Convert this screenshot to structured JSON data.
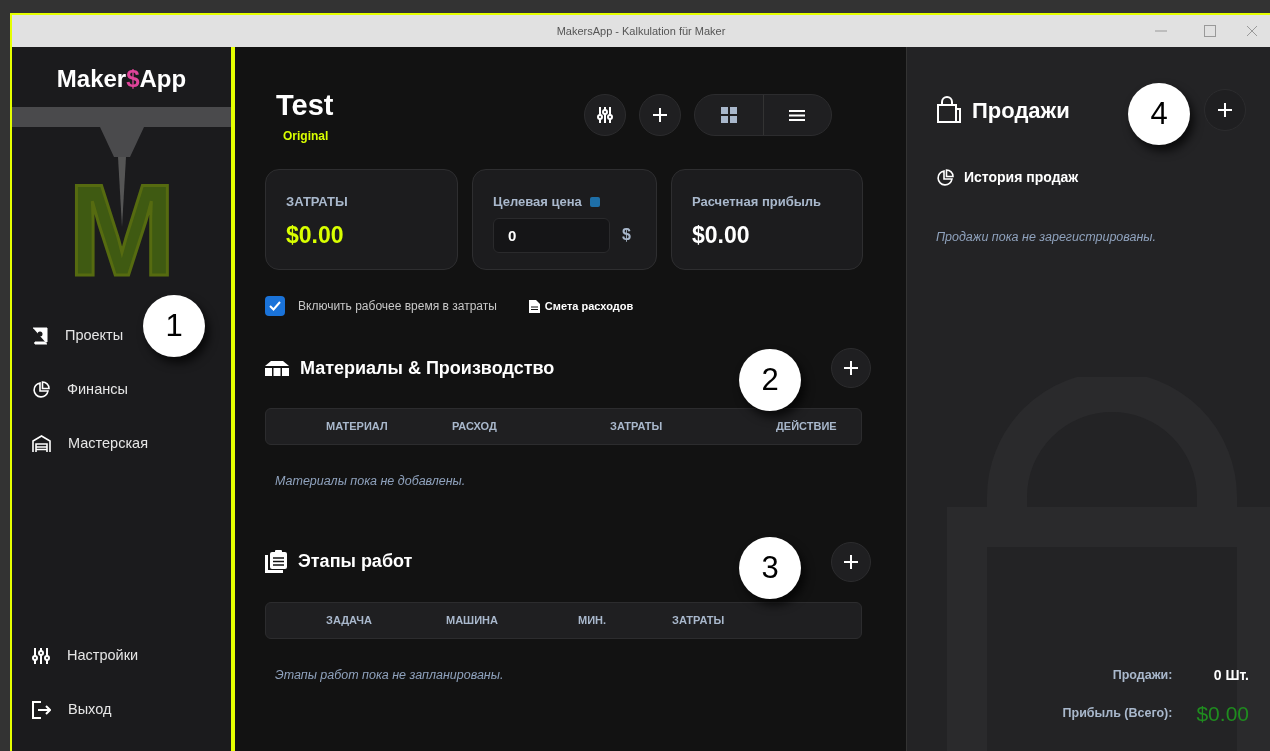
{
  "window": {
    "title": "MakersApp - Kalkulation für Maker"
  },
  "sidebar": {
    "logo": {
      "before": "Maker",
      "symbol": "$",
      "after": "App",
      "art_letter": "M"
    },
    "nav": [
      {
        "kind": "projects",
        "label": "Проекты"
      },
      {
        "kind": "finance",
        "label": "Финансы"
      },
      {
        "kind": "workshop",
        "label": "Мастерская"
      }
    ],
    "bottom_nav": [
      {
        "kind": "settings",
        "label": "Настройки"
      },
      {
        "kind": "logout",
        "label": "Выход"
      }
    ]
  },
  "project": {
    "title": "Test",
    "variant": "Original"
  },
  "cards": [
    {
      "kind": "value",
      "label": "ЗАТРАТЫ",
      "value": "$0.00",
      "highlight": true
    },
    {
      "kind": "input",
      "label": "Целевая цена",
      "value": "0",
      "unit": "$",
      "info": true
    },
    {
      "kind": "value",
      "label": "Расчетная прибыль",
      "value": "$0.00",
      "highlight": false
    }
  ],
  "include_work_time": {
    "label": "Включить рабочее время в затраты",
    "checked": true
  },
  "cost_estimate_link": "Смета расходов",
  "sections": [
    {
      "kind": "materials",
      "title": "Материалы & Производство",
      "columns": [
        "МАТЕРИАЛ",
        "РАСХОД",
        "ЗАТРАТЫ",
        "ДЕЙСТВИЕ"
      ],
      "empty": "Материалы пока не добавлены."
    },
    {
      "kind": "steps",
      "title": "Этапы работ",
      "columns": [
        "ЗАДАЧА",
        "МАШИНА",
        "МИН.",
        "ЗАТРАТЫ"
      ],
      "empty": "Этапы работ пока не запланированы."
    }
  ],
  "sales": {
    "title": "Продажи",
    "history_title": "История продаж",
    "empty": "Продажи пока не зарегистрированы.",
    "count_label": "Продажи:",
    "count": "0 Шт.",
    "profit_label": "Прибыль (Всего):",
    "profit": "$0.00"
  },
  "callouts": [
    "1",
    "2",
    "3",
    "4"
  ]
}
